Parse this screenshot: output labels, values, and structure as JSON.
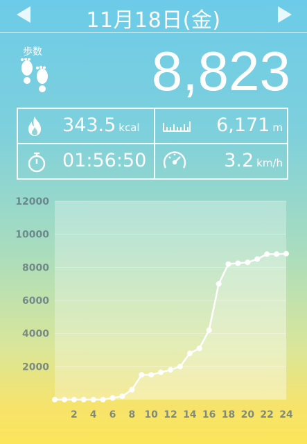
{
  "header": {
    "date": "11月18日(金)",
    "prev_icon": "triangle-left-icon",
    "next_icon": "triangle-right-icon"
  },
  "steps": {
    "label": "歩数",
    "value": "8,823",
    "icon": "footprints-icon"
  },
  "stats": {
    "calories": {
      "value": "343.5",
      "unit": "kcal",
      "icon": "flame-icon"
    },
    "distance": {
      "value": "6,171",
      "unit": "m",
      "icon": "ruler-icon"
    },
    "time": {
      "value": "01:56:50",
      "icon": "stopwatch-icon"
    },
    "speed": {
      "value": "3.2",
      "unit": "km/h",
      "icon": "speedometer-icon"
    }
  },
  "colors": {
    "line": "#ffffff",
    "text": "#ffffff"
  },
  "chart_data": {
    "type": "line",
    "xlabel": "",
    "ylabel": "",
    "x": [
      0,
      1,
      2,
      3,
      4,
      5,
      6,
      7,
      8,
      9,
      10,
      11,
      12,
      13,
      14,
      15,
      16,
      17,
      18,
      19,
      20,
      21,
      22,
      23,
      24
    ],
    "values": [
      0,
      0,
      0,
      0,
      0,
      0,
      100,
      200,
      600,
      1500,
      1500,
      1650,
      1800,
      2000,
      2800,
      3100,
      4200,
      7000,
      8200,
      8250,
      8300,
      8500,
      8800,
      8800,
      8823
    ],
    "x_ticks": [
      "2",
      "4",
      "6",
      "8",
      "10",
      "12",
      "14",
      "16",
      "18",
      "20",
      "22",
      "24"
    ],
    "y_ticks": [
      "2000",
      "4000",
      "6000",
      "8000",
      "10000",
      "12000"
    ],
    "xlim": [
      0,
      24
    ],
    "ylim": [
      0,
      12000
    ],
    "grid": true
  }
}
